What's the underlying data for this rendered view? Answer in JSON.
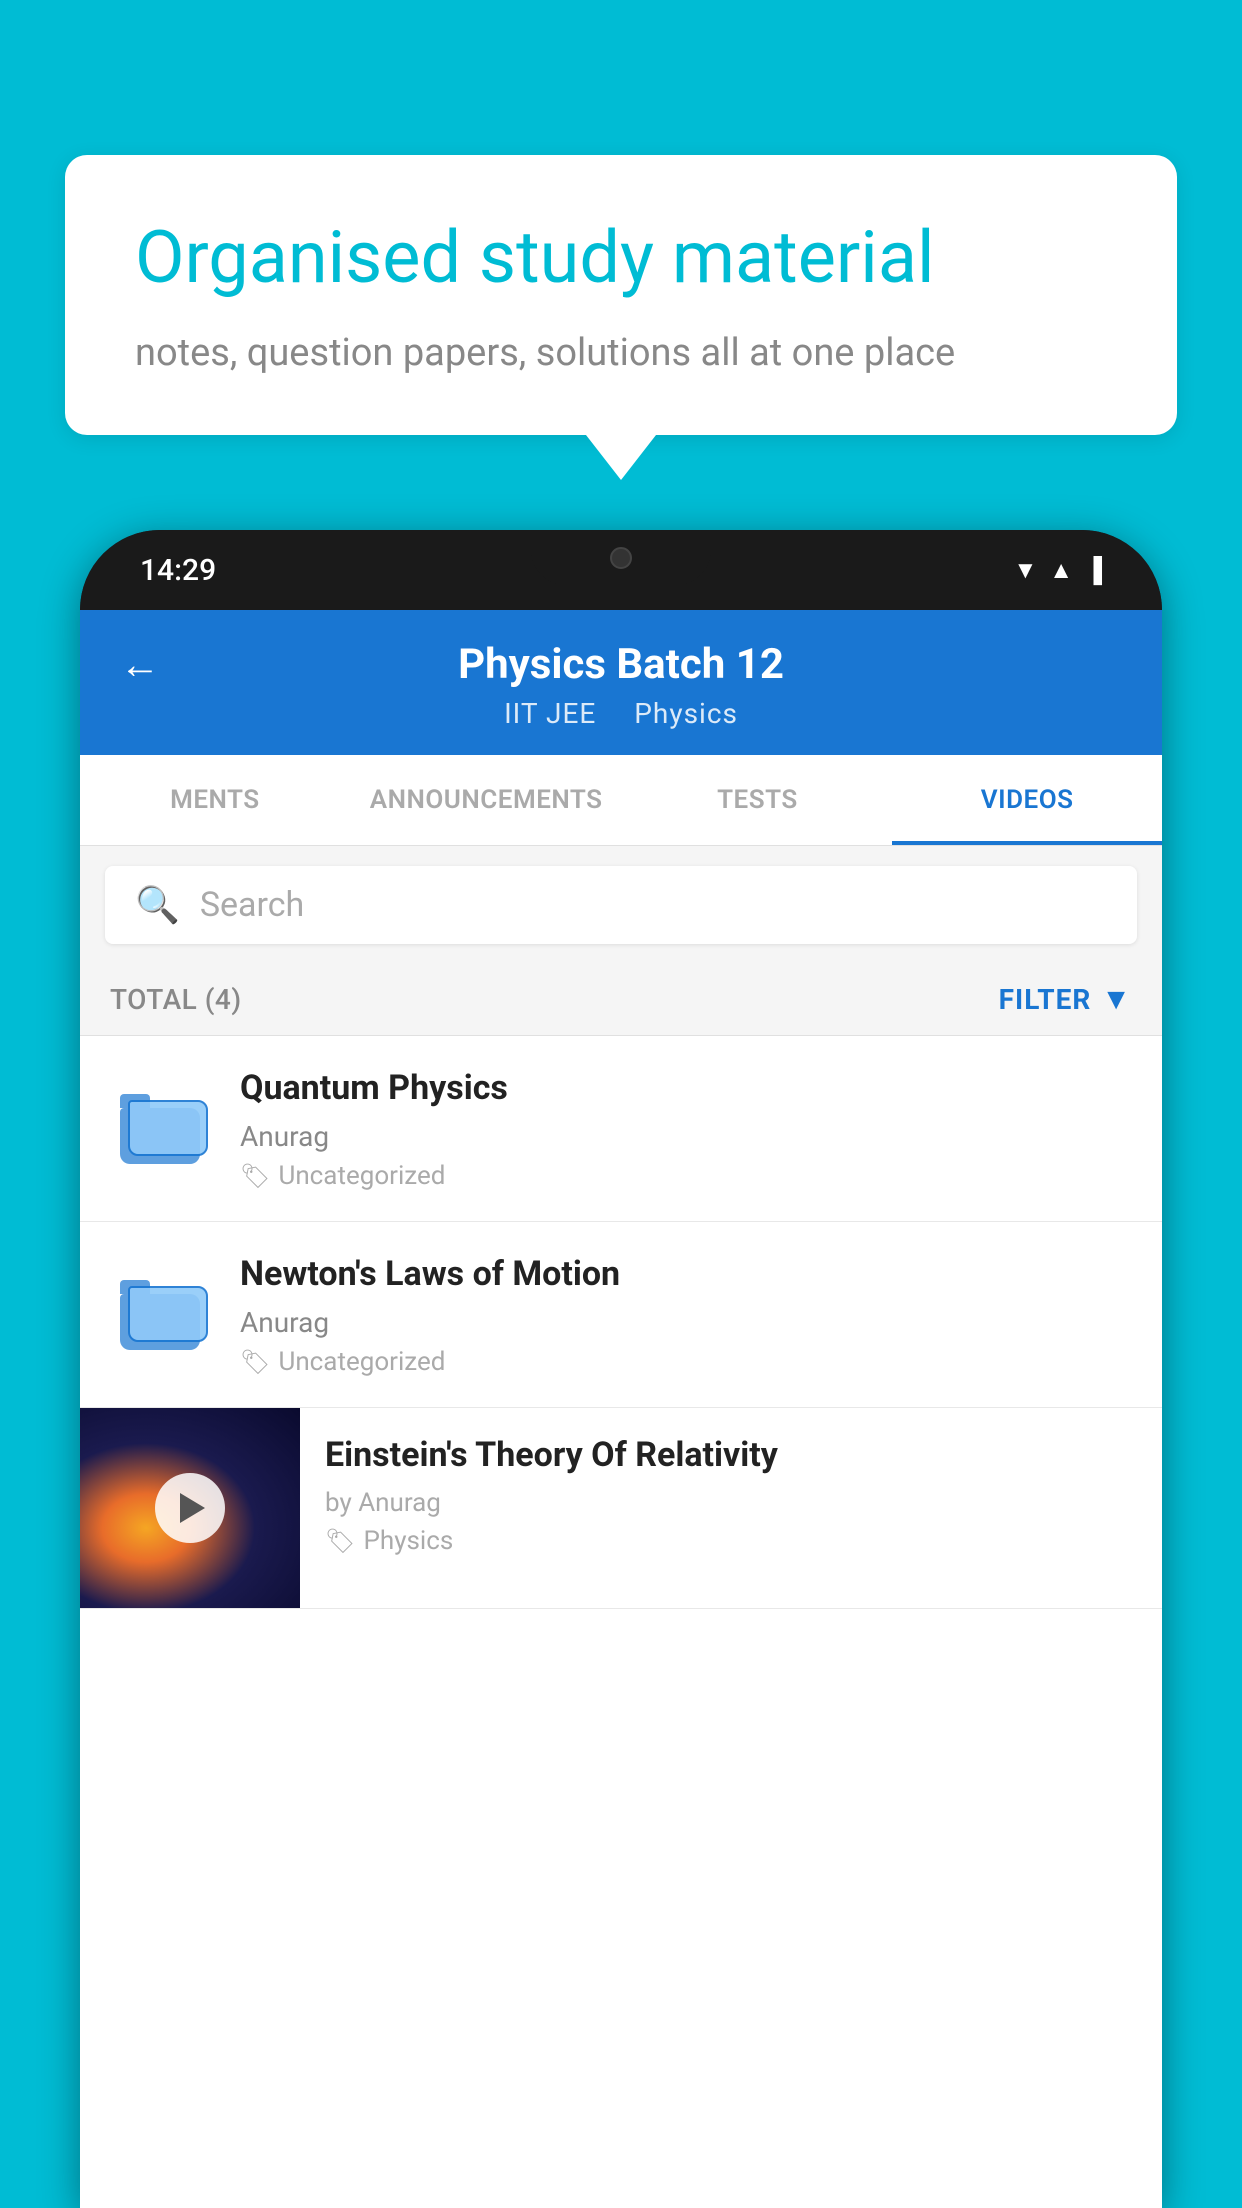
{
  "background_color": "#00BCD4",
  "speech_bubble": {
    "title": "Organised study material",
    "subtitle": "notes, question papers, solutions all at one place"
  },
  "phone": {
    "time": "14:29",
    "header": {
      "title": "Physics Batch 12",
      "breadcrumb_part1": "IIT JEE",
      "breadcrumb_part2": "Physics"
    },
    "tabs": [
      {
        "label": "MENTS",
        "active": false
      },
      {
        "label": "ANNOUNCEMENTS",
        "active": false
      },
      {
        "label": "TESTS",
        "active": false
      },
      {
        "label": "VIDEOS",
        "active": true
      }
    ],
    "search": {
      "placeholder": "Search"
    },
    "filter_bar": {
      "total_label": "TOTAL (4)",
      "filter_label": "FILTER"
    },
    "videos": [
      {
        "title": "Quantum Physics",
        "author": "Anurag",
        "tag": "Uncategorized",
        "has_thumbnail": false
      },
      {
        "title": "Newton's Laws of Motion",
        "author": "Anurag",
        "tag": "Uncategorized",
        "has_thumbnail": false
      },
      {
        "title": "Einstein's Theory Of Relativity",
        "author": "by Anurag",
        "tag": "Physics",
        "has_thumbnail": true
      }
    ]
  }
}
